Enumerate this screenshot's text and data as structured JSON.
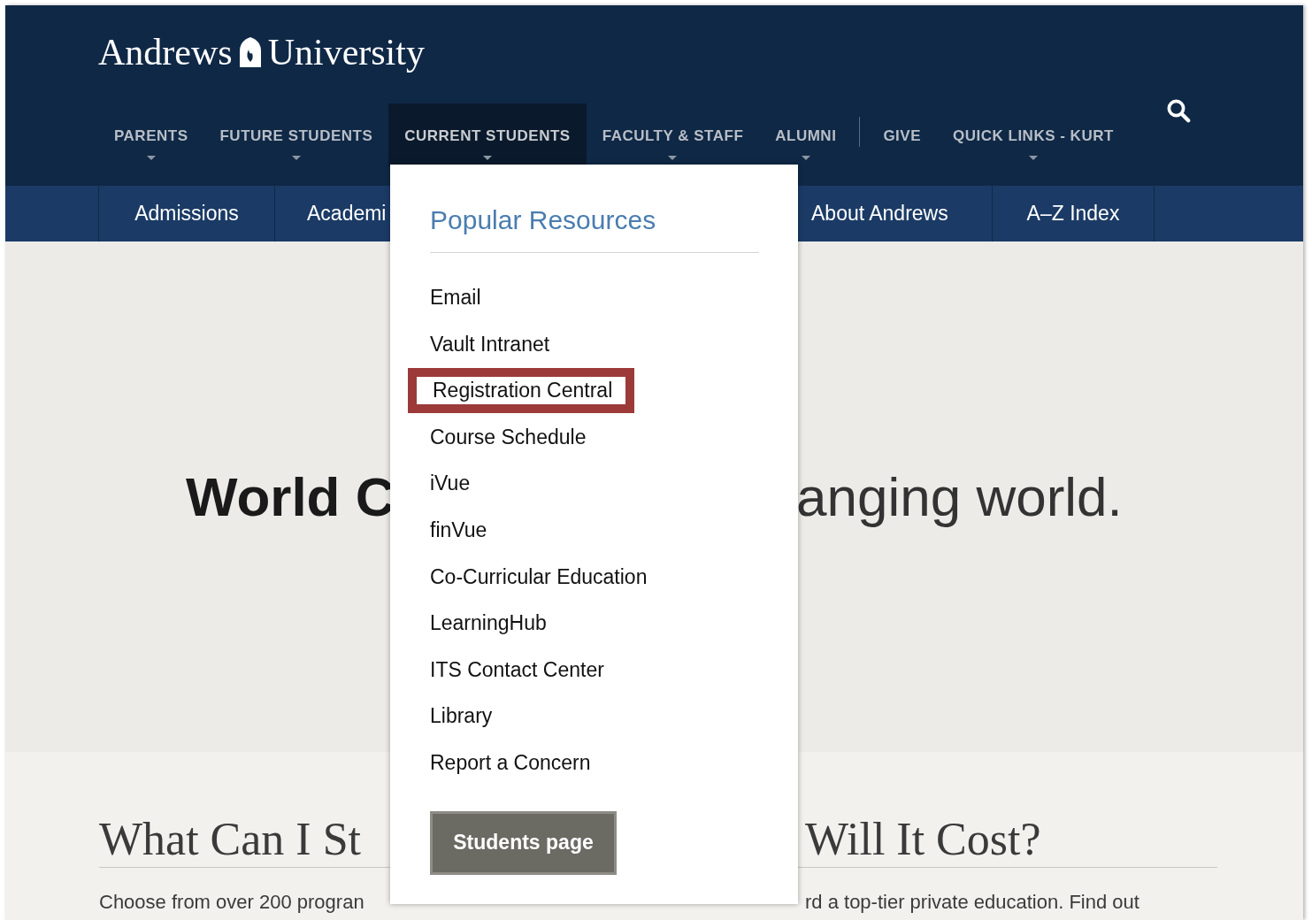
{
  "logo": {
    "word_1": "Andrews",
    "word_2": "University"
  },
  "main_nav": [
    {
      "label": "PARENTS",
      "dropdown": true,
      "selected": false
    },
    {
      "label": "FUTURE STUDENTS",
      "dropdown": true,
      "selected": false
    },
    {
      "label": "CURRENT STUDENTS",
      "dropdown": true,
      "selected": true
    },
    {
      "label": "FACULTY & STAFF",
      "dropdown": true,
      "selected": false
    },
    {
      "label": "ALUMNI",
      "dropdown": true,
      "selected": false
    },
    {
      "label": "GIVE",
      "dropdown": false,
      "selected": false
    },
    {
      "label": "QUICK LINKS - KURT",
      "dropdown": true,
      "selected": false
    }
  ],
  "sub_nav": [
    "Admissions",
    "Academi",
    "About Andrews",
    "A–Z Index"
  ],
  "hero": {
    "left": "World C",
    "right": "anging world."
  },
  "sections": [
    {
      "heading": "What Can I St",
      "text": "Choose from over 200 progran"
    },
    {
      "heading": "Will It Cost?",
      "text": "rd a top-tier private education. Find out"
    }
  ],
  "dropdown": {
    "title": "Popular Resources",
    "items": [
      {
        "label": "Email",
        "highlighted": false
      },
      {
        "label": "Vault Intranet",
        "highlighted": false
      },
      {
        "label": "Registration Central",
        "highlighted": true
      },
      {
        "label": "Course Schedule",
        "highlighted": false
      },
      {
        "label": "iVue",
        "highlighted": false
      },
      {
        "label": "finVue",
        "highlighted": false
      },
      {
        "label": "Co-Curricular Education",
        "highlighted": false
      },
      {
        "label": "LearningHub",
        "highlighted": false
      },
      {
        "label": "ITS Contact Center",
        "highlighted": false
      },
      {
        "label": "Library",
        "highlighted": false
      },
      {
        "label": "Report a Concern",
        "highlighted": false
      }
    ],
    "button": "Students page"
  }
}
